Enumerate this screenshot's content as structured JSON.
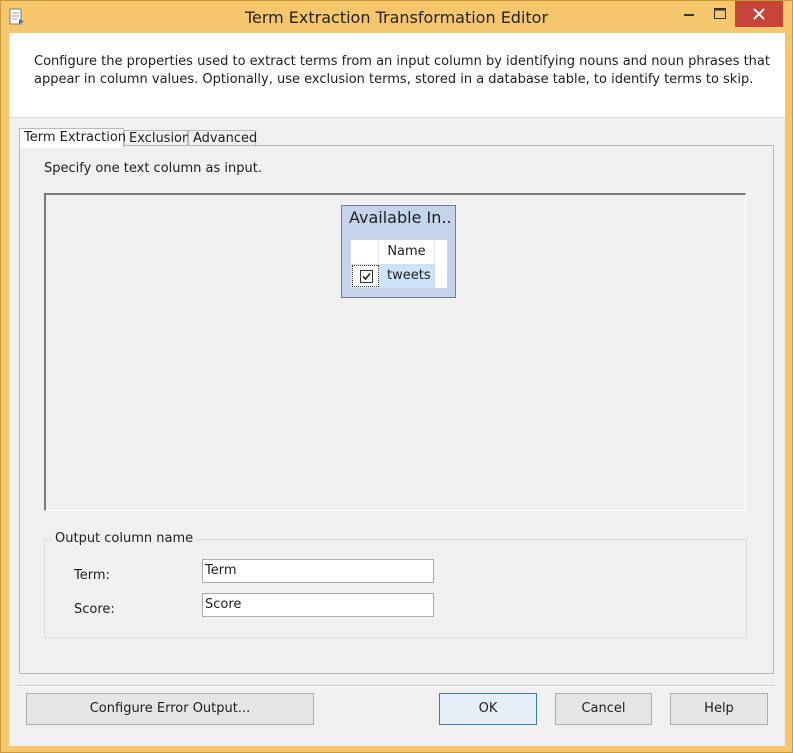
{
  "window": {
    "title": "Term Extraction Transformation Editor",
    "accent_color": "#f5c66b",
    "close_color": "#c7443a",
    "controls": [
      "minimize-icon",
      "maximize-icon",
      "close-icon"
    ]
  },
  "description": "Configure the properties used to extract terms from an input column by identifying nouns and noun phrases that appear in column values. Optionally, use exclusion terms, stored in a database table, to identify terms to skip.",
  "tabs": [
    {
      "label": "Term Extraction",
      "active": true
    },
    {
      "label": "Exclusion",
      "active": false
    },
    {
      "label": "Advanced",
      "active": false
    }
  ],
  "term_tab": {
    "instruction": "Specify one text column as input.",
    "available_inputs": {
      "title": "Available In...",
      "column_header": "Name",
      "rows": [
        {
          "name": "tweets",
          "checked": true
        }
      ]
    },
    "output_group": {
      "title": "Output column name",
      "term_label": "Term:",
      "term_value": "Term",
      "score_label": "Score:",
      "score_value": "Score"
    }
  },
  "buttons": {
    "configure_error_output": "Configure Error Output...",
    "ok": "OK",
    "cancel": "Cancel",
    "help": "Help"
  }
}
